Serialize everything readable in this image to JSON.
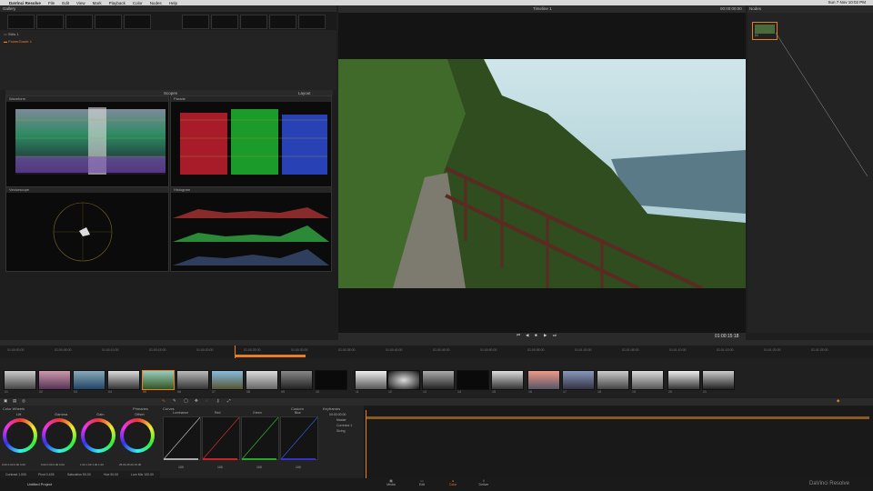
{
  "menubar": {
    "app": "DaVinci Resolve",
    "items": [
      "File",
      "Edit",
      "View",
      "Mark",
      "Playback",
      "Color",
      "Nodes",
      "Help"
    ],
    "status": "Sun 7 Nov 10:02 PM"
  },
  "gallery": {
    "title": "Gallery",
    "albums": [
      "Stills 1",
      "PowerGrade 1"
    ]
  },
  "scopes": {
    "title": "Scopes",
    "layout_label": "Layout",
    "waveform": "Waveform",
    "parade": "Parade",
    "vectorscope": "Vectorscope",
    "histogram": "Histogram"
  },
  "viewer": {
    "timeline_name": "Timeline 1",
    "timecode": "01:00:15:18",
    "header_tc": "00:00:00:00"
  },
  "nodes": {
    "title": "Nodes",
    "node_label": "01"
  },
  "clips": {
    "count": 21,
    "labels": [
      "01",
      "02",
      "03",
      "04",
      "05",
      "06",
      "07",
      "08",
      "09",
      "10",
      "11",
      "12",
      "13",
      "14",
      "15",
      "16",
      "17",
      "18",
      "19",
      "20",
      "21"
    ],
    "selected": 5
  },
  "timeline_ticks": [
    "01:00:00:00",
    "01:00:05:00",
    "01:00:10:00",
    "01:00:15:00",
    "01:00:20:00",
    "01:00:25:00",
    "01:00:30:00",
    "01:00:35:00",
    "01:00:40:00",
    "01:00:45:00",
    "01:00:50:00",
    "01:00:55:00",
    "01:01:00:00",
    "01:01:05:00",
    "01:01:10:00",
    "01:01:15:00",
    "01:01:20:00",
    "01:01:25:00"
  ],
  "color_wheels": {
    "title": "Color Wheels",
    "mode": "Primaries",
    "wheels": [
      {
        "name": "Lift",
        "values": "0.00  0.00  0.00  0.00"
      },
      {
        "name": "Gamma",
        "values": "0.00  0.00  0.00  0.00"
      },
      {
        "name": "Gain",
        "values": "1.00  1.00  1.00  1.00"
      },
      {
        "name": "Offset",
        "values": "25.00  25.00  25.00"
      }
    ],
    "footer": [
      "Contrast 1.000",
      "Pivot 0.435",
      "Saturation 50.00",
      "Hue 50.00",
      "Lum Mix 100.00"
    ]
  },
  "curves": {
    "title": "Curves",
    "mode": "Custom",
    "channels": [
      {
        "name": "Luminance",
        "intensity": "100"
      },
      {
        "name": "Red",
        "intensity": "100"
      },
      {
        "name": "Green",
        "intensity": "100"
      },
      {
        "name": "Blue",
        "intensity": "100"
      }
    ]
  },
  "keyframes": {
    "title": "Keyframes",
    "timecode": "00:00:00:00",
    "tracks": [
      "Master",
      "Corrector 1",
      "Sizing"
    ]
  },
  "bottom_nav": {
    "items": [
      "Media",
      "Edit",
      "Color",
      "Deliver"
    ],
    "active": "Color",
    "project": "Untitled Project",
    "brand": "DaVinci Resolve"
  },
  "colors": {
    "accent": "#e67e22",
    "panel": "#232324",
    "bg": "#1e1e1f"
  }
}
